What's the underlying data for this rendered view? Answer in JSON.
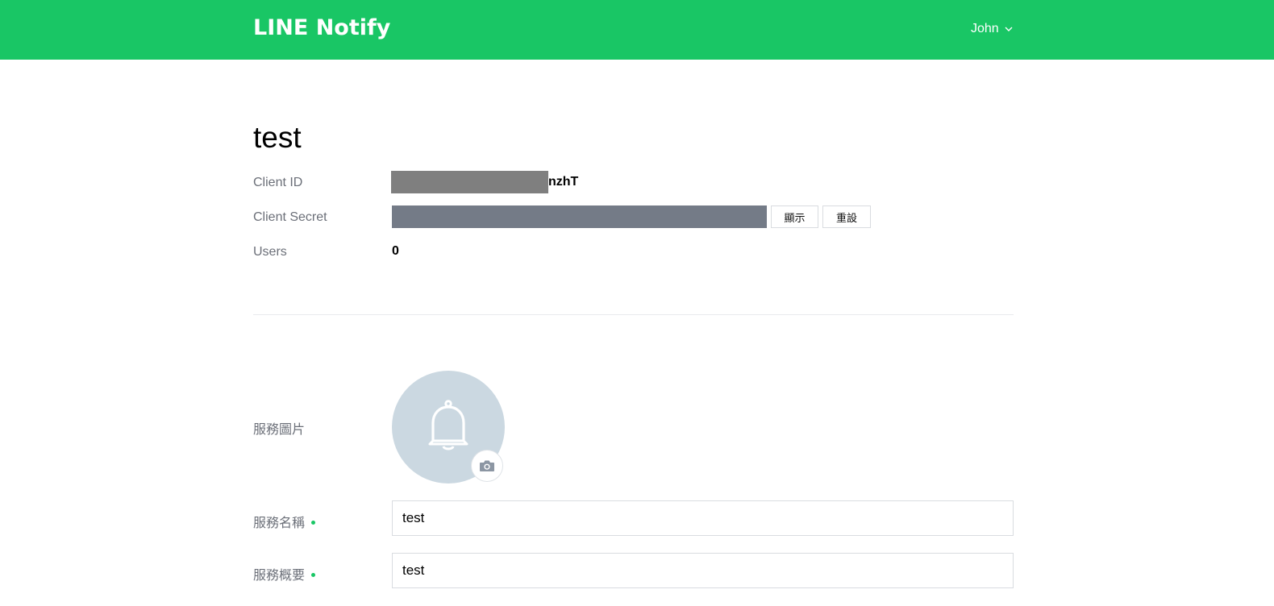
{
  "header": {
    "logo": "LINE Notify",
    "user_name": "John",
    "brand_color": "#19c665"
  },
  "service": {
    "title": "test",
    "client_id_label": "Client ID",
    "client_id_visible_suffix": "nzhT",
    "client_secret_label": "Client Secret",
    "show_button": "顯示",
    "reset_button": "重設",
    "users_label": "Users",
    "users_value": "0"
  },
  "form": {
    "image_label": "服務圖片",
    "image_icon": "bell-icon",
    "camera_icon": "camera-icon",
    "name_label": "服務名稱",
    "name_value": "test",
    "summary_label": "服務概要",
    "summary_value": "test"
  }
}
